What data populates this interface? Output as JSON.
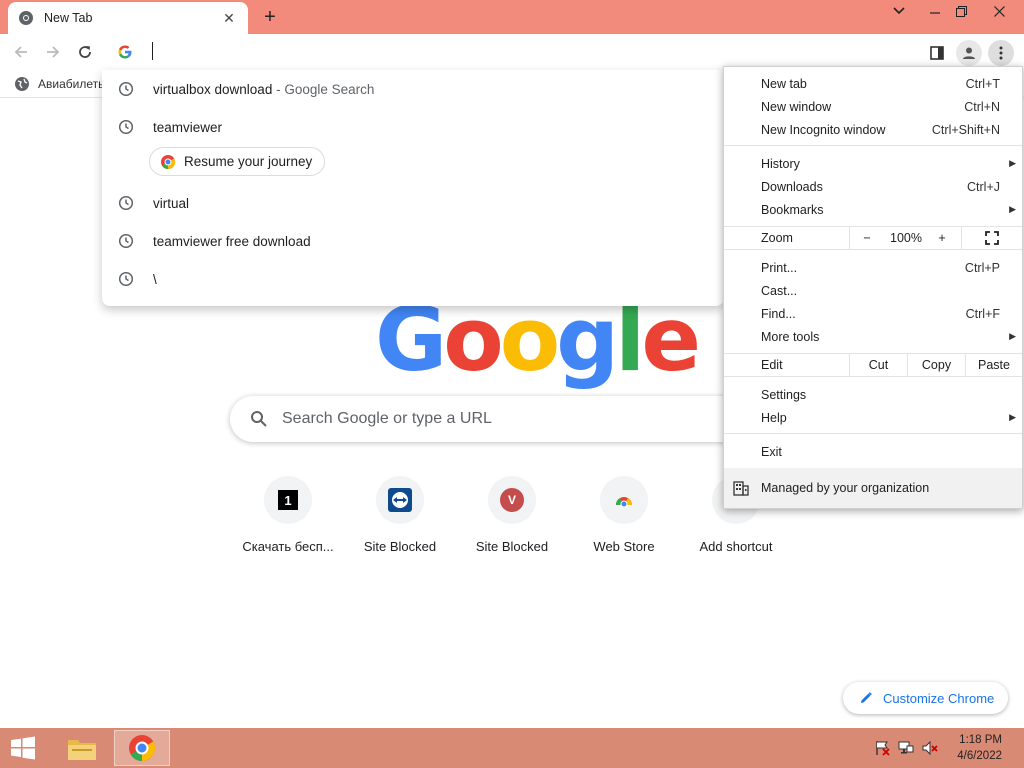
{
  "tab": {
    "title": "New Tab",
    "close_glyph": "✕",
    "new_tab_glyph": "+"
  },
  "bookmarks": [
    {
      "label": "Авиабилеты"
    }
  ],
  "omnibox": {
    "value": ""
  },
  "suggestions": [
    {
      "text": "virtualbox download",
      "sub": " - Google Search"
    },
    {
      "text": "teamviewer",
      "sub": ""
    },
    {
      "text": "virtual",
      "sub": ""
    },
    {
      "text": "teamviewer free download",
      "sub": ""
    },
    {
      "text": "\\",
      "sub": ""
    }
  ],
  "journey_chip": {
    "label": "Resume your journey"
  },
  "search": {
    "placeholder": "Search Google or type a URL"
  },
  "logo_letters": [
    "G",
    "o",
    "o",
    "g",
    "l",
    "e"
  ],
  "shortcuts": [
    {
      "label": "Скачать бесп...",
      "glyph": "1"
    },
    {
      "label": "Site Blocked",
      "glyph": ""
    },
    {
      "label": "Site Blocked",
      "glyph": "V"
    },
    {
      "label": "Web Store",
      "glyph": ""
    },
    {
      "label": "Add shortcut",
      "glyph": ""
    }
  ],
  "customize": {
    "label": "Customize Chrome"
  },
  "menu": {
    "new_tab": {
      "label": "New tab",
      "key": "Ctrl+T"
    },
    "new_window": {
      "label": "New window",
      "key": "Ctrl+N"
    },
    "new_incognito": {
      "label": "New Incognito window",
      "key": "Ctrl+Shift+N"
    },
    "history": {
      "label": "History"
    },
    "downloads": {
      "label": "Downloads",
      "key": "Ctrl+J"
    },
    "bookmarks": {
      "label": "Bookmarks"
    },
    "zoom": {
      "label": "Zoom",
      "minus": "−",
      "level": "100%",
      "plus": "+"
    },
    "print": {
      "label": "Print...",
      "key": "Ctrl+P"
    },
    "cast": {
      "label": "Cast..."
    },
    "find": {
      "label": "Find...",
      "key": "Ctrl+F"
    },
    "more_tools": {
      "label": "More tools"
    },
    "edit": {
      "label": "Edit",
      "cut": "Cut",
      "copy": "Copy",
      "paste": "Paste"
    },
    "settings": {
      "label": "Settings"
    },
    "help": {
      "label": "Help"
    },
    "exit": {
      "label": "Exit"
    },
    "managed": {
      "label": "Managed by your organization"
    }
  },
  "taskbar": {
    "time": "1:18 PM",
    "date": "4/6/2022"
  },
  "colors": {
    "titlebar": "#f28b7b",
    "taskbar": "#d98a74",
    "accent": "#1a73e8",
    "google_blue": "#4285f4",
    "google_red": "#ea4335",
    "google_yellow": "#fbbc05",
    "google_green": "#34a853"
  }
}
